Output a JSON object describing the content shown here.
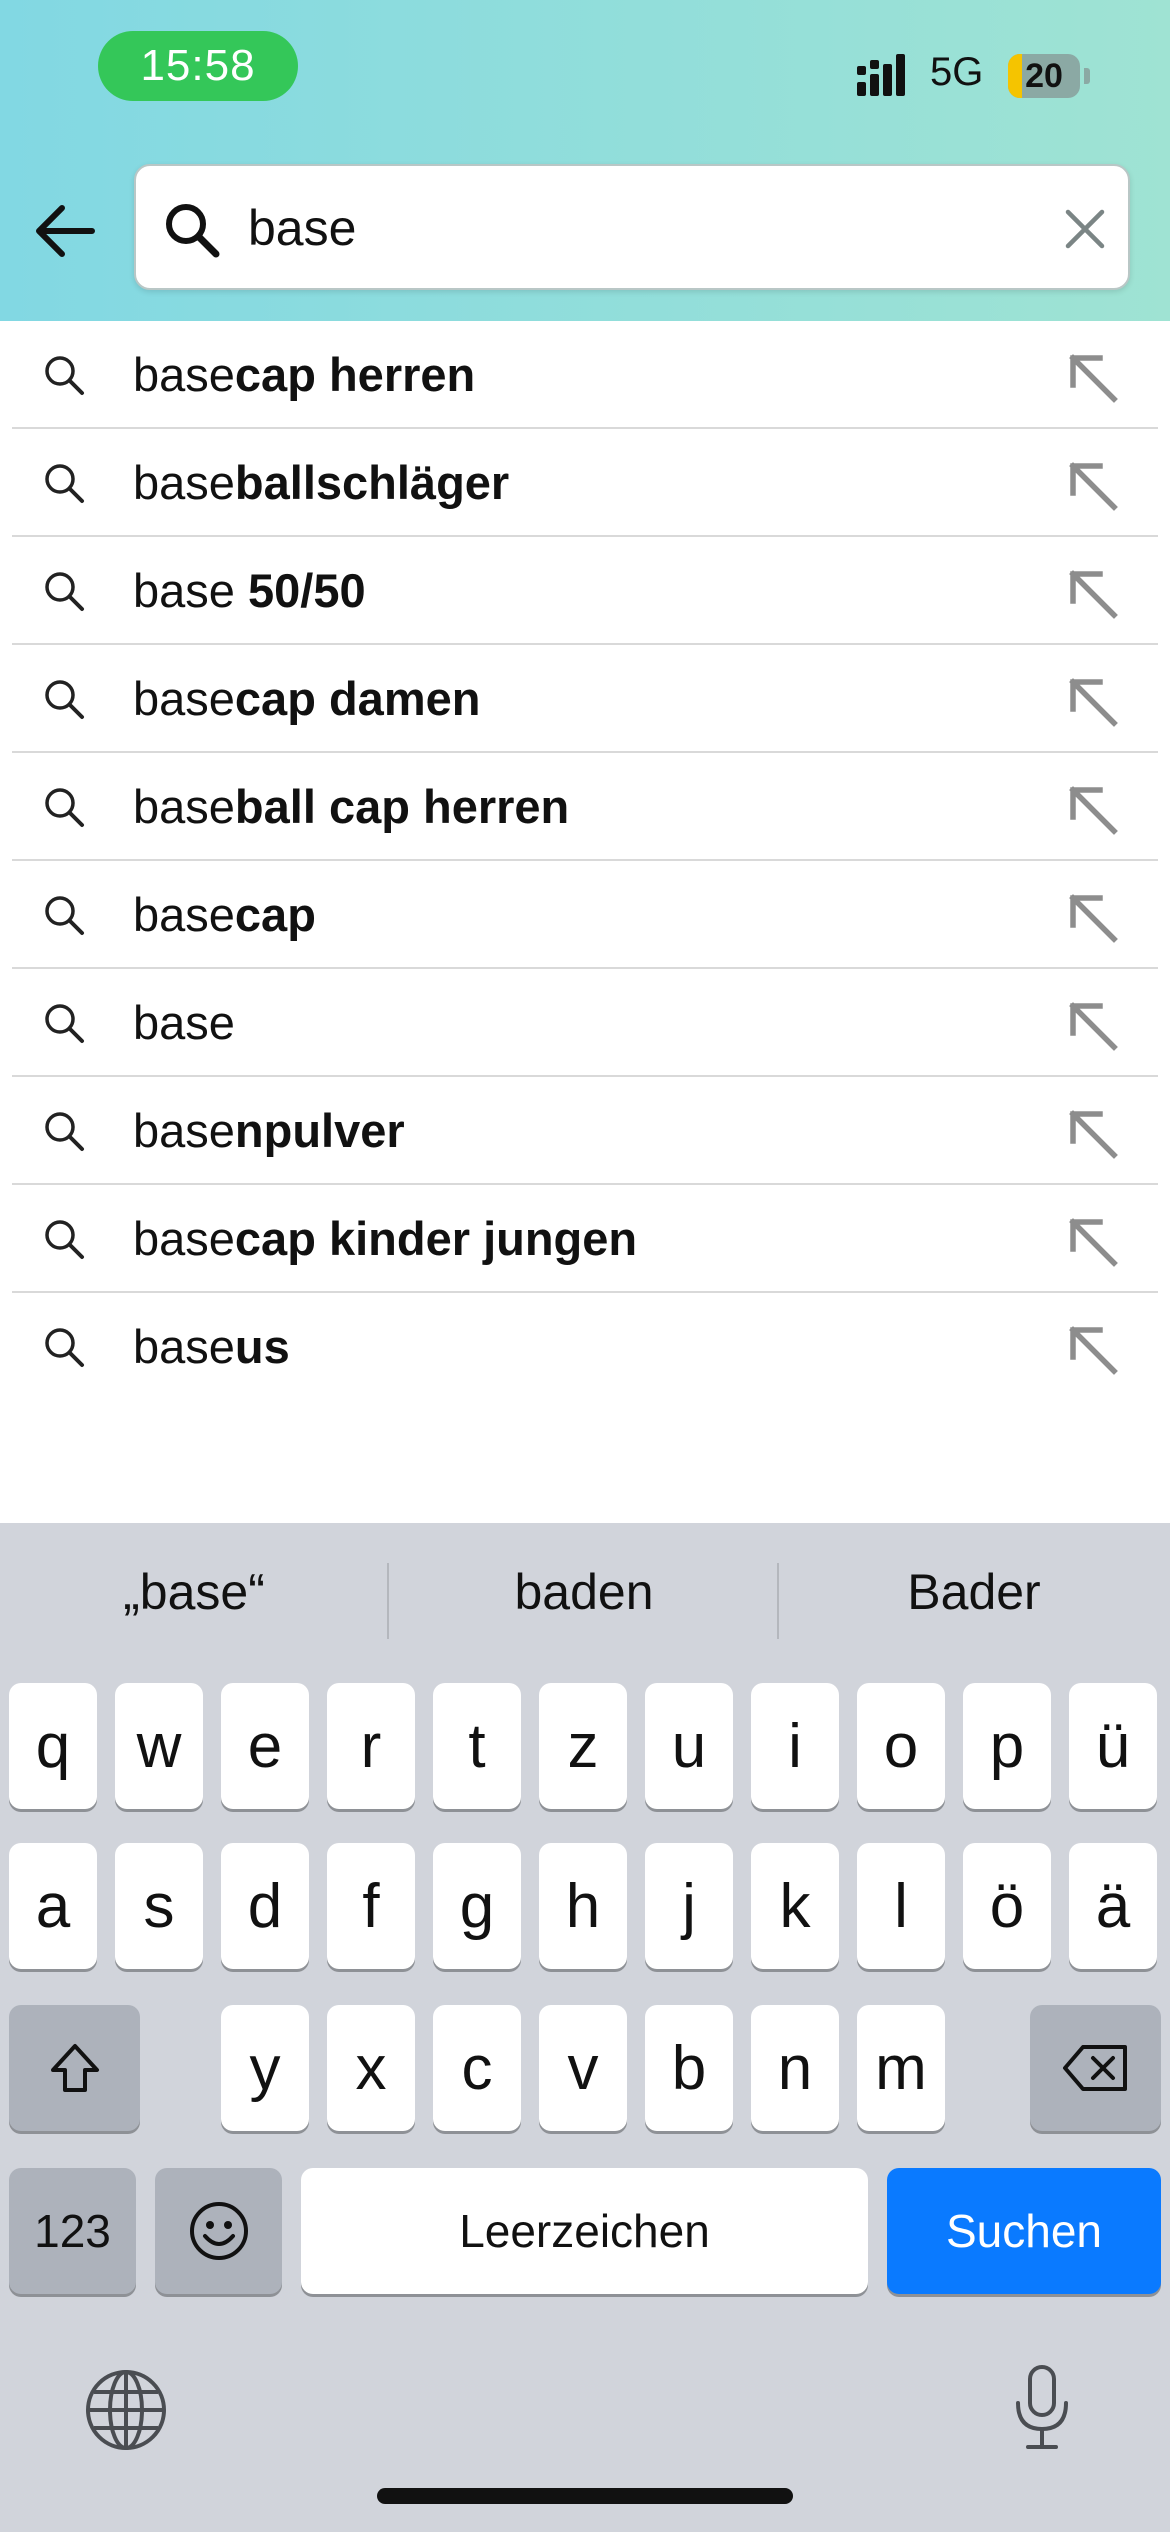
{
  "status_bar": {
    "time": "15:58",
    "network": "5G",
    "battery": "20",
    "time_pill_color": "#34c759"
  },
  "search": {
    "value": "base",
    "back_icon": "arrow-left-icon",
    "search_icon": "search-icon",
    "clear_icon": "close-icon"
  },
  "suggestions": [
    {
      "prefix": "base",
      "rest": "cap herren"
    },
    {
      "prefix": "base",
      "rest": "ballschläger"
    },
    {
      "prefix": "base",
      "rest": " 50/50"
    },
    {
      "prefix": "base",
      "rest": "cap damen"
    },
    {
      "prefix": "base",
      "rest": "ball cap herren"
    },
    {
      "prefix": "base",
      "rest": "cap"
    },
    {
      "prefix": "base",
      "rest": ""
    },
    {
      "prefix": "base",
      "rest": "npulver"
    },
    {
      "prefix": "base",
      "rest": "cap kinder jungen"
    },
    {
      "prefix": "base",
      "rest": "us"
    }
  ],
  "keyboard": {
    "predictions": [
      "„base“",
      "baden",
      "Bader"
    ],
    "row1": [
      "q",
      "w",
      "e",
      "r",
      "t",
      "z",
      "u",
      "i",
      "o",
      "p",
      "ü"
    ],
    "row2": [
      "a",
      "s",
      "d",
      "f",
      "g",
      "h",
      "j",
      "k",
      "l",
      "ö",
      "ä"
    ],
    "row3": [
      "y",
      "x",
      "c",
      "v",
      "b",
      "n",
      "m"
    ],
    "numbers_label": "123",
    "space_label": "Leerzeichen",
    "return_label": "Suchen",
    "return_color": "#0a7aff"
  }
}
